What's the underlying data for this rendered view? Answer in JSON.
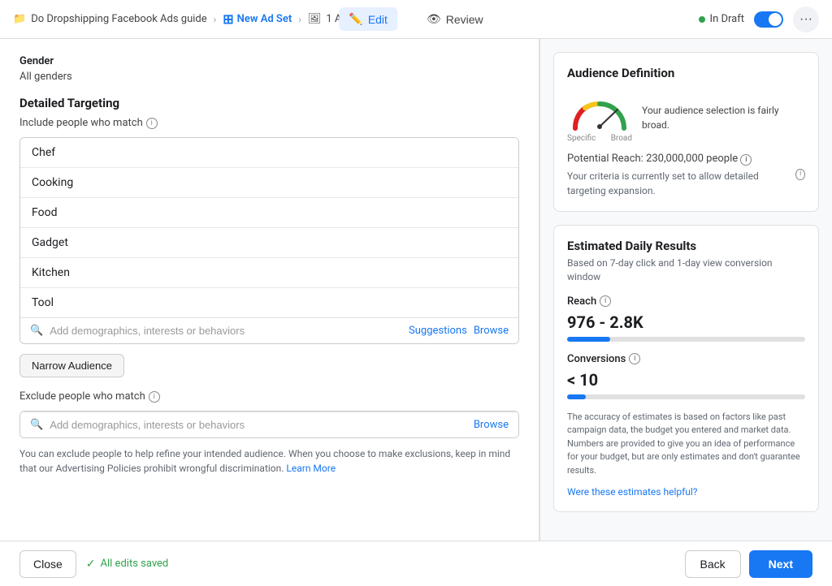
{
  "topbar": {
    "breadcrumb": {
      "campaign": "Do Dropshipping Facebook Ads guide",
      "adset": "New Ad Set",
      "ad": "1 Ad"
    },
    "tabs": {
      "edit": "Edit",
      "review": "Review"
    },
    "status": "In Draft"
  },
  "left": {
    "gender_label": "Gender",
    "gender_value": "All genders",
    "detailed_targeting_label": "Detailed Targeting",
    "include_label": "Include people who match",
    "targeting_items": [
      "Chef",
      "Cooking",
      "Food",
      "Gadget",
      "Kitchen",
      "Tool"
    ],
    "search_placeholder": "Add demographics, interests or behaviors",
    "suggestions_label": "Suggestions",
    "browse_label": "Browse",
    "narrow_audience_label": "Narrow Audience",
    "exclude_label": "Exclude people who match",
    "exclude_placeholder": "Add demographics, interests or behaviors",
    "exclude_browse": "Browse",
    "helper_text": "You can exclude people to help refine your intended audience. When you choose to make exclusions, keep in mind that our Advertising Policies prohibit wrongful discrimination.",
    "learn_more": "Learn More"
  },
  "right": {
    "audience_definition": {
      "title": "Audience Definition",
      "specific_label": "Specific",
      "broad_label": "Broad",
      "description": "Your audience selection is fairly broad.",
      "potential_reach_label": "Potential Reach:",
      "potential_reach_value": "230,000,000 people",
      "expansion_text": "Your criteria is currently set to allow detailed targeting expansion."
    },
    "estimated_daily": {
      "title": "Estimated Daily Results",
      "subtitle": "Based on 7-day click and 1-day view conversion window",
      "reach_label": "Reach",
      "reach_value": "976 - 2.8K",
      "conversions_label": "Conversions",
      "conversions_value": "< 10",
      "accuracy_text": "The accuracy of estimates is based on factors like past campaign data, the budget you entered and market data. Numbers are provided to give you an idea of performance for your budget, but are only estimates and don't guarantee results.",
      "helpful_link": "Were these estimates helpful?"
    }
  },
  "bottom": {
    "close_label": "Close",
    "saved_label": "All edits saved",
    "back_label": "Back",
    "next_label": "Next"
  }
}
